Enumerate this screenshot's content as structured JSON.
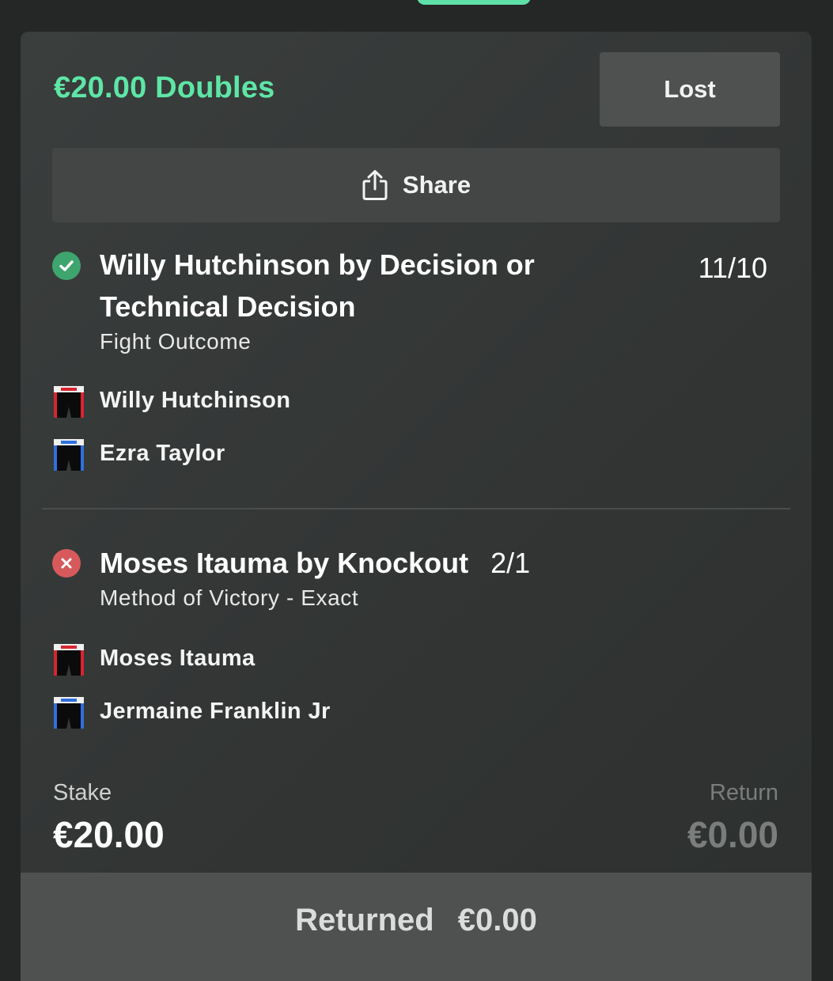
{
  "bet": {
    "title": "€20.00 Doubles",
    "status": "Lost",
    "share_label": "Share",
    "selections": [
      {
        "result": "won",
        "result_icon": "check-circle-icon",
        "name_line1": "Willy Hutchinson by Decision or",
        "name_line2": "Technical Decision",
        "odds": "11/10",
        "market": "Fight Outcome",
        "fighters": [
          {
            "name": "Willy Hutchinson",
            "corner": "red",
            "icon": "red-corner-shorts-icon"
          },
          {
            "name": "Ezra Taylor",
            "corner": "blue",
            "icon": "blue-corner-shorts-icon"
          }
        ]
      },
      {
        "result": "lost",
        "result_icon": "x-circle-icon",
        "name_line1": "Moses Itauma by Knockout",
        "odds": "2/1",
        "market": "Method of Victory - Exact",
        "fighters": [
          {
            "name": "Moses Itauma",
            "corner": "red",
            "icon": "red-corner-shorts-icon"
          },
          {
            "name": "Jermaine Franklin Jr",
            "corner": "blue",
            "icon": "blue-corner-shorts-icon"
          }
        ]
      }
    ],
    "stake_label": "Stake",
    "stake_value": "€20.00",
    "return_label": "Return",
    "return_value": "€0.00",
    "returned_label": "Returned",
    "returned_value": "€0.00"
  },
  "colors": {
    "accent_green": "#5ee6a6",
    "won": "#3fa56f",
    "lost": "#d65a5c",
    "red_corner": "#d9252f",
    "blue_corner": "#2f6fe0"
  }
}
